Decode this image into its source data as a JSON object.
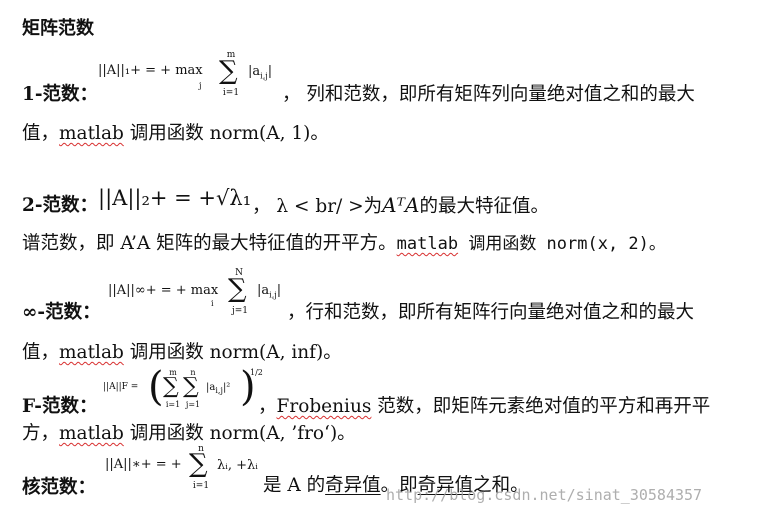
{
  "title": "矩阵范数",
  "norm1": {
    "label": "1-范数：",
    "formula_left": "||A||₁+ = + max",
    "max_sub": "j",
    "sum_top": "m",
    "sum_bottom": "i=1",
    "term": "|a",
    "term_sub": "i,j",
    "term_end": "|",
    "text_after": "，  列和范数，即所有矩阵列向量绝对值之和的最大",
    "text_line2_a": "值，",
    "text_line2_matlab": "matlab",
    "text_line2_b": " 调用函数 norm(A, 1)。"
  },
  "norm2": {
    "label": "2-范数：",
    "formula": "||A||₂+ = +√λ₁",
    "text_after_a": "，  λ < br/ >为",
    "text_ATA": "AᵀA",
    "text_after_b": "的最大特征值。",
    "line2_a": "谱范数，即 A’A 矩阵的最大特征值的开平方。",
    "line2_matlab": "matlab",
    "line2_b": " 调用函数 norm(x,  2)。"
  },
  "norminf": {
    "label": "∞-范数：",
    "formula_left": "||A||∞+ = + max",
    "max_sub": "i",
    "sum_top": "N",
    "sum_bottom": "j=1",
    "term": "|a",
    "term_sub": "i,j",
    "term_end": "|",
    "text_after": "，行和范数，即所有矩阵行向量绝对值之和的最大",
    "text_line2_a": "值，",
    "text_line2_matlab": "matlab",
    "text_line2_b": " 调用函数 norm(A, inf)。"
  },
  "normF": {
    "label": "F-范数：",
    "formula_left": "||A||F =",
    "sum1_top": "m",
    "sum1_bottom": "i=1",
    "sum2_top": "n",
    "sum2_bottom": "j=1",
    "term": "|a",
    "term_sub": "i,j",
    "term_end": "|²",
    "exponent": "1/2",
    "text_after_a": "，",
    "text_frobenius": "Frobenius",
    "text_after_b": " 范数，即矩阵元素绝对值的平方和再开平",
    "line2_a": "方，",
    "line2_matlab": "matlab",
    "line2_b": " 调用函数 norm(A, ’fro‘)。"
  },
  "normNuclear": {
    "label": "核范数：",
    "formula_left": "||A||∗+ = +",
    "sum_top": "n",
    "sum_bottom": "i=1",
    "term": "λᵢ, +λᵢ",
    "text_a": "是 A 的",
    "text_singular": "奇异值",
    "text_b": "。即",
    "text_singular2": "奇异值",
    "text_c": "之和。"
  },
  "watermark": "http://blog.csdn.net/sinat_30584357"
}
